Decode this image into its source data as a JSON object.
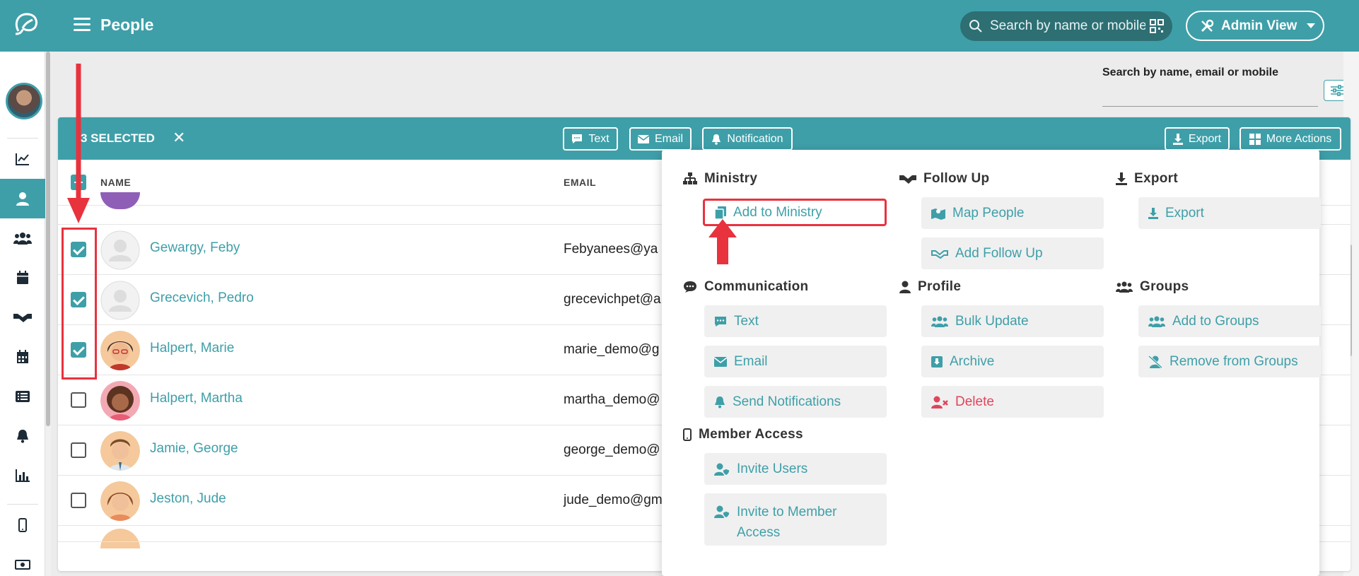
{
  "topbar": {
    "title": "People",
    "search_placeholder": "Search by name or mobile",
    "admin_view_label": "Admin View"
  },
  "right_search": {
    "label": "Search by name, email or mobile"
  },
  "sidebar": {
    "items": [
      {
        "icon": "chart-line-icon"
      },
      {
        "icon": "person-icon",
        "active": true
      },
      {
        "icon": "users-icon"
      },
      {
        "icon": "calendar-icon"
      },
      {
        "icon": "handshake-icon"
      },
      {
        "icon": "calendar-grid-icon"
      },
      {
        "icon": "list-icon"
      },
      {
        "icon": "bell-icon"
      },
      {
        "icon": "bar-chart-icon"
      },
      {
        "icon": "mobile-icon"
      },
      {
        "icon": "money-icon"
      }
    ]
  },
  "panel": {
    "selected_label": "3 SELECTED",
    "clear_symbol": "✕",
    "buttons": {
      "text": "Text",
      "email": "Email",
      "notification": "Notification",
      "export": "Export",
      "more_actions": "More Actions"
    },
    "columns": {
      "name": "NAME",
      "email": "EMAIL"
    }
  },
  "rows": [
    {
      "name": "Gewargy, Feby",
      "email": "Febyanees@ya",
      "checked": true,
      "avatar": "placeholder"
    },
    {
      "name": "Grecevich, Pedro",
      "email": "grecevichpet@a",
      "checked": true,
      "avatar": "placeholder"
    },
    {
      "name": "Halpert, Marie",
      "email": "marie_demo@g",
      "checked": true,
      "avatar": "marie"
    },
    {
      "name": "Halpert, Martha",
      "email": "martha_demo@",
      "checked": false,
      "avatar": "martha"
    },
    {
      "name": "Jamie, George",
      "email": "george_demo@",
      "checked": false,
      "avatar": "george"
    },
    {
      "name": "Jeston, Jude",
      "email": "jude_demo@gm",
      "checked": false,
      "avatar": "jude"
    }
  ],
  "menu": {
    "ministry": {
      "title": "Ministry",
      "items": [
        "Add to Ministry"
      ]
    },
    "follow_up": {
      "title": "Follow Up",
      "items": [
        "Map People",
        "Add Follow Up"
      ]
    },
    "export": {
      "title": "Export",
      "items": [
        "Export"
      ]
    },
    "communication": {
      "title": "Communication",
      "items": [
        "Text",
        "Email",
        "Send Notifications"
      ]
    },
    "profile": {
      "title": "Profile",
      "items": [
        "Bulk Update",
        "Archive",
        "Delete"
      ]
    },
    "groups": {
      "title": "Groups",
      "items": [
        "Add to Groups",
        "Remove from Groups"
      ]
    },
    "member_access": {
      "title": "Member Access",
      "items": [
        "Invite Users",
        "Invite to Member Access"
      ]
    }
  },
  "colors": {
    "brand": "#3e9fa8",
    "danger": "#e0455c",
    "annotation": "#e8323e"
  }
}
